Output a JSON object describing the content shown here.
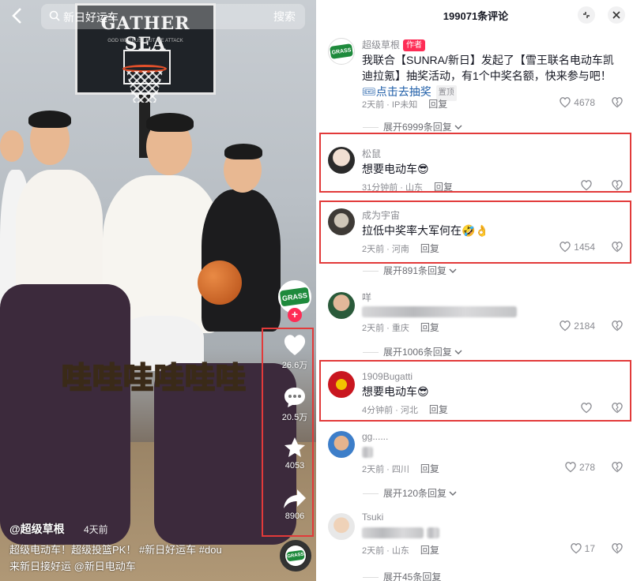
{
  "video": {
    "search_text": "新日好运车",
    "search_button": "搜索",
    "backboard_text": "GATHER SEA",
    "backboard_sub": "GOD WE TRUST BUT WE ATTACK",
    "big_caption": "哇哇哇哇哇哇",
    "author_handle": "@超级草根",
    "time_ago": "4天前",
    "description_line1": "超级电动车！超级投篮PK！ #新日好运车 #dou",
    "description_line2": "来新日接好运 @新日电动车",
    "likes": "26.6万",
    "comments": "20.5万",
    "favorites": "4053",
    "shares": "8906",
    "logo_text": "GRASS"
  },
  "comments_panel": {
    "title": "199071条评论",
    "items": [
      {
        "name": "超级草根",
        "author_tag": "作者",
        "text": "我联合【SUNRA/新日】发起了【雪王联名电动车凯迪拉氪】抽奖活动，有1个中奖名额，快来参与吧！",
        "link_text": "点击去抽奖",
        "pin_tag": "置顶",
        "meta": "2天前 · IP未知",
        "reply": "回复",
        "likes": "4678",
        "expand": "展开6999条回复"
      },
      {
        "name": "松鼠",
        "text": "想要电动车😎",
        "meta": "31分钟前 · 山东",
        "reply": "回复",
        "likes": ""
      },
      {
        "name": "成为宇宙",
        "text": "拉低中奖率大军何在🤣👌",
        "meta": "2天前 · 河南",
        "reply": "回复",
        "likes": "1454",
        "expand": "展开891条回复"
      },
      {
        "name": "咩",
        "text": "",
        "meta": "2天前 · 重庆",
        "reply": "回复",
        "likes": "2184",
        "expand": "展开1006条回复"
      },
      {
        "name": "1909Bugatti",
        "text": "想要电动车😎",
        "meta": "4分钟前 · 河北",
        "reply": "回复",
        "likes": ""
      },
      {
        "name": "gg......",
        "text": "",
        "meta": "2天前 · 四川",
        "reply": "回复",
        "likes": "278",
        "expand": "展开120条回复"
      },
      {
        "name": "Tsuki",
        "text": "",
        "meta": "2天前 · 山东",
        "reply": "回复",
        "likes": "17",
        "expand": "展开45条回复"
      }
    ]
  },
  "colors": {
    "accent_red": "#fe2c55",
    "highlight_box": "#e23a3a",
    "link_blue": "#1f5ea8",
    "grass_green": "#1e8a3c"
  },
  "icons": [
    "back-arrow-icon",
    "search-icon",
    "plus-icon",
    "heart-icon",
    "comment-icon",
    "star-icon",
    "share-icon",
    "collapse-icon",
    "close-icon",
    "dislike-icon",
    "chevron-down-icon"
  ]
}
